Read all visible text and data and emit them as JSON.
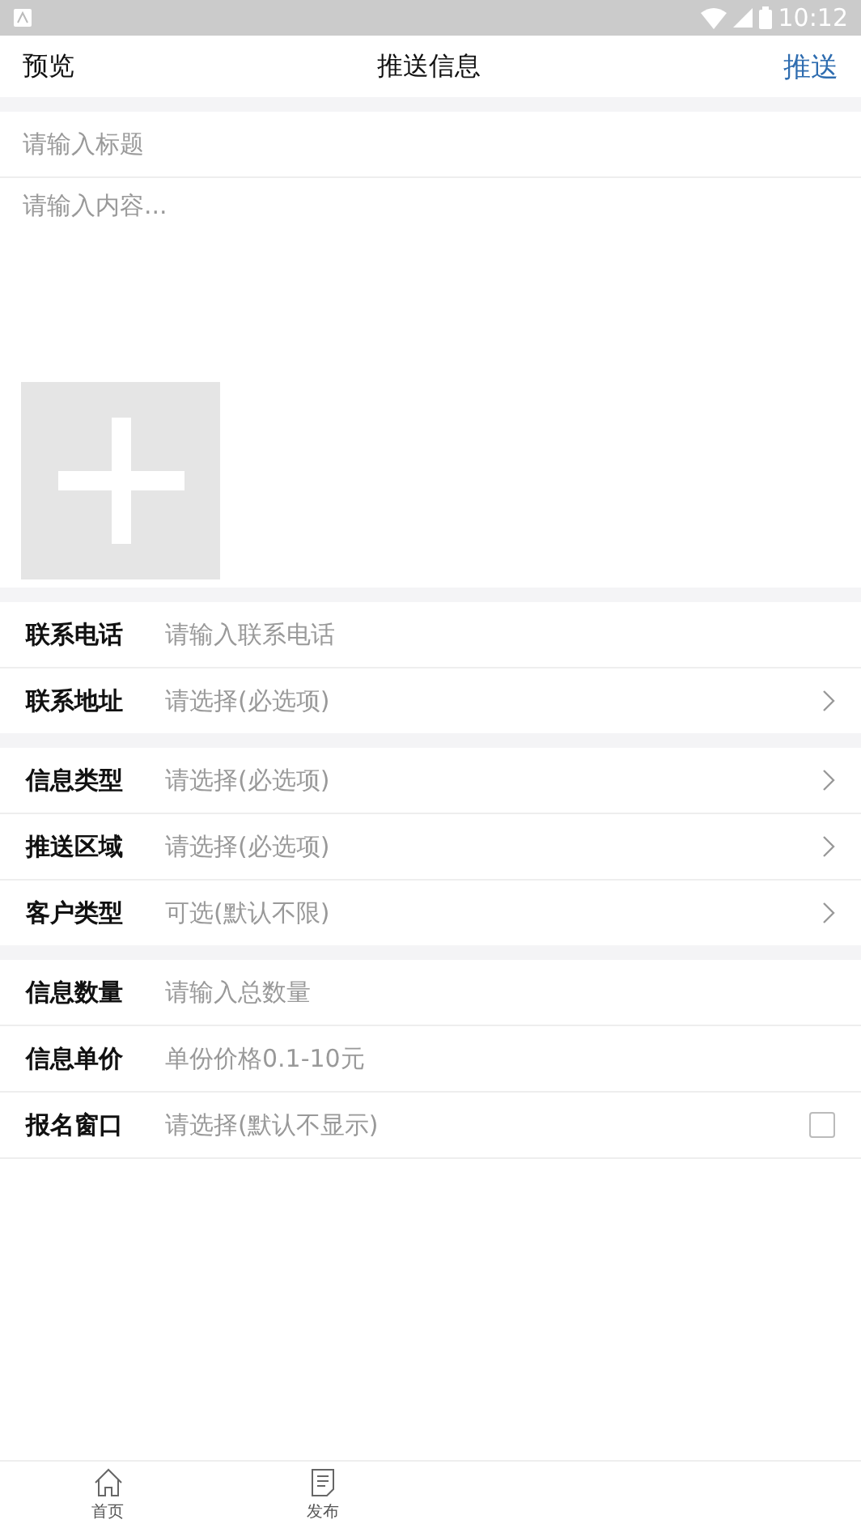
{
  "status_bar": {
    "time": "10:12"
  },
  "header": {
    "left": "预览",
    "title": "推送信息",
    "right": "推送"
  },
  "title_field": {
    "placeholder": "请输入标题"
  },
  "content_field": {
    "placeholder": "请输入内容..."
  },
  "groups": [
    {
      "rows": [
        {
          "kind": "input",
          "label": "联系电话",
          "placeholder": "请输入联系电话"
        },
        {
          "kind": "select",
          "label": "联系地址",
          "placeholder": "请选择(必选项)"
        }
      ]
    },
    {
      "rows": [
        {
          "kind": "select",
          "label": "信息类型",
          "placeholder": "请选择(必选项)"
        },
        {
          "kind": "select",
          "label": "推送区域",
          "placeholder": "请选择(必选项)"
        },
        {
          "kind": "select",
          "label": "客户类型",
          "placeholder": "可选(默认不限)"
        }
      ]
    },
    {
      "rows": [
        {
          "kind": "input",
          "label": "信息数量",
          "placeholder": "请输入总数量"
        },
        {
          "kind": "input",
          "label": "信息单价",
          "placeholder": "单份价格0.1-10元"
        },
        {
          "kind": "checkbox",
          "label": "报名窗口",
          "placeholder": "请选择(默认不显示)",
          "checked": false
        }
      ]
    }
  ],
  "tab_bar": [
    {
      "kind": "home",
      "label": "首页"
    },
    {
      "kind": "document",
      "label": "发布"
    }
  ]
}
